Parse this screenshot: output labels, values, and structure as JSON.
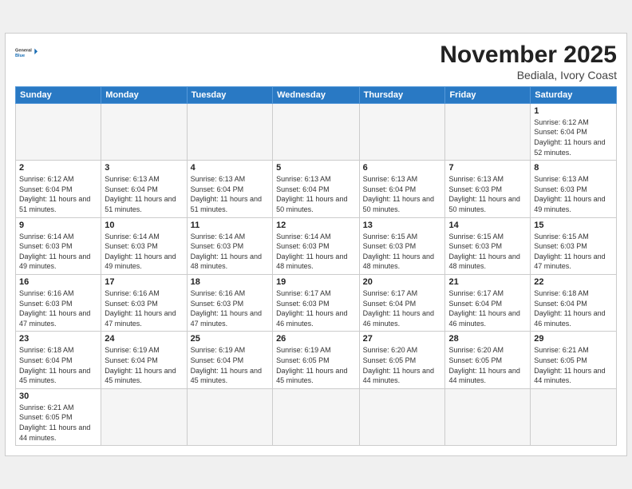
{
  "header": {
    "logo_general": "General",
    "logo_blue": "Blue",
    "month_title": "November 2025",
    "location": "Bediala, Ivory Coast"
  },
  "days_of_week": [
    "Sunday",
    "Monday",
    "Tuesday",
    "Wednesday",
    "Thursday",
    "Friday",
    "Saturday"
  ],
  "weeks": [
    [
      {
        "day": "",
        "sunrise": "",
        "sunset": "",
        "daylight": "",
        "empty": true
      },
      {
        "day": "",
        "sunrise": "",
        "sunset": "",
        "daylight": "",
        "empty": true
      },
      {
        "day": "",
        "sunrise": "",
        "sunset": "",
        "daylight": "",
        "empty": true
      },
      {
        "day": "",
        "sunrise": "",
        "sunset": "",
        "daylight": "",
        "empty": true
      },
      {
        "day": "",
        "sunrise": "",
        "sunset": "",
        "daylight": "",
        "empty": true
      },
      {
        "day": "",
        "sunrise": "",
        "sunset": "",
        "daylight": "",
        "empty": true
      },
      {
        "day": "1",
        "sunrise": "Sunrise: 6:12 AM",
        "sunset": "Sunset: 6:04 PM",
        "daylight": "Daylight: 11 hours and 52 minutes.",
        "empty": false
      }
    ],
    [
      {
        "day": "2",
        "sunrise": "Sunrise: 6:12 AM",
        "sunset": "Sunset: 6:04 PM",
        "daylight": "Daylight: 11 hours and 51 minutes.",
        "empty": false
      },
      {
        "day": "3",
        "sunrise": "Sunrise: 6:13 AM",
        "sunset": "Sunset: 6:04 PM",
        "daylight": "Daylight: 11 hours and 51 minutes.",
        "empty": false
      },
      {
        "day": "4",
        "sunrise": "Sunrise: 6:13 AM",
        "sunset": "Sunset: 6:04 PM",
        "daylight": "Daylight: 11 hours and 51 minutes.",
        "empty": false
      },
      {
        "day": "5",
        "sunrise": "Sunrise: 6:13 AM",
        "sunset": "Sunset: 6:04 PM",
        "daylight": "Daylight: 11 hours and 50 minutes.",
        "empty": false
      },
      {
        "day": "6",
        "sunrise": "Sunrise: 6:13 AM",
        "sunset": "Sunset: 6:04 PM",
        "daylight": "Daylight: 11 hours and 50 minutes.",
        "empty": false
      },
      {
        "day": "7",
        "sunrise": "Sunrise: 6:13 AM",
        "sunset": "Sunset: 6:03 PM",
        "daylight": "Daylight: 11 hours and 50 minutes.",
        "empty": false
      },
      {
        "day": "8",
        "sunrise": "Sunrise: 6:13 AM",
        "sunset": "Sunset: 6:03 PM",
        "daylight": "Daylight: 11 hours and 49 minutes.",
        "empty": false
      }
    ],
    [
      {
        "day": "9",
        "sunrise": "Sunrise: 6:14 AM",
        "sunset": "Sunset: 6:03 PM",
        "daylight": "Daylight: 11 hours and 49 minutes.",
        "empty": false
      },
      {
        "day": "10",
        "sunrise": "Sunrise: 6:14 AM",
        "sunset": "Sunset: 6:03 PM",
        "daylight": "Daylight: 11 hours and 49 minutes.",
        "empty": false
      },
      {
        "day": "11",
        "sunrise": "Sunrise: 6:14 AM",
        "sunset": "Sunset: 6:03 PM",
        "daylight": "Daylight: 11 hours and 48 minutes.",
        "empty": false
      },
      {
        "day": "12",
        "sunrise": "Sunrise: 6:14 AM",
        "sunset": "Sunset: 6:03 PM",
        "daylight": "Daylight: 11 hours and 48 minutes.",
        "empty": false
      },
      {
        "day": "13",
        "sunrise": "Sunrise: 6:15 AM",
        "sunset": "Sunset: 6:03 PM",
        "daylight": "Daylight: 11 hours and 48 minutes.",
        "empty": false
      },
      {
        "day": "14",
        "sunrise": "Sunrise: 6:15 AM",
        "sunset": "Sunset: 6:03 PM",
        "daylight": "Daylight: 11 hours and 48 minutes.",
        "empty": false
      },
      {
        "day": "15",
        "sunrise": "Sunrise: 6:15 AM",
        "sunset": "Sunset: 6:03 PM",
        "daylight": "Daylight: 11 hours and 47 minutes.",
        "empty": false
      }
    ],
    [
      {
        "day": "16",
        "sunrise": "Sunrise: 6:16 AM",
        "sunset": "Sunset: 6:03 PM",
        "daylight": "Daylight: 11 hours and 47 minutes.",
        "empty": false
      },
      {
        "day": "17",
        "sunrise": "Sunrise: 6:16 AM",
        "sunset": "Sunset: 6:03 PM",
        "daylight": "Daylight: 11 hours and 47 minutes.",
        "empty": false
      },
      {
        "day": "18",
        "sunrise": "Sunrise: 6:16 AM",
        "sunset": "Sunset: 6:03 PM",
        "daylight": "Daylight: 11 hours and 47 minutes.",
        "empty": false
      },
      {
        "day": "19",
        "sunrise": "Sunrise: 6:17 AM",
        "sunset": "Sunset: 6:03 PM",
        "daylight": "Daylight: 11 hours and 46 minutes.",
        "empty": false
      },
      {
        "day": "20",
        "sunrise": "Sunrise: 6:17 AM",
        "sunset": "Sunset: 6:04 PM",
        "daylight": "Daylight: 11 hours and 46 minutes.",
        "empty": false
      },
      {
        "day": "21",
        "sunrise": "Sunrise: 6:17 AM",
        "sunset": "Sunset: 6:04 PM",
        "daylight": "Daylight: 11 hours and 46 minutes.",
        "empty": false
      },
      {
        "day": "22",
        "sunrise": "Sunrise: 6:18 AM",
        "sunset": "Sunset: 6:04 PM",
        "daylight": "Daylight: 11 hours and 46 minutes.",
        "empty": false
      }
    ],
    [
      {
        "day": "23",
        "sunrise": "Sunrise: 6:18 AM",
        "sunset": "Sunset: 6:04 PM",
        "daylight": "Daylight: 11 hours and 45 minutes.",
        "empty": false
      },
      {
        "day": "24",
        "sunrise": "Sunrise: 6:19 AM",
        "sunset": "Sunset: 6:04 PM",
        "daylight": "Daylight: 11 hours and 45 minutes.",
        "empty": false
      },
      {
        "day": "25",
        "sunrise": "Sunrise: 6:19 AM",
        "sunset": "Sunset: 6:04 PM",
        "daylight": "Daylight: 11 hours and 45 minutes.",
        "empty": false
      },
      {
        "day": "26",
        "sunrise": "Sunrise: 6:19 AM",
        "sunset": "Sunset: 6:05 PM",
        "daylight": "Daylight: 11 hours and 45 minutes.",
        "empty": false
      },
      {
        "day": "27",
        "sunrise": "Sunrise: 6:20 AM",
        "sunset": "Sunset: 6:05 PM",
        "daylight": "Daylight: 11 hours and 44 minutes.",
        "empty": false
      },
      {
        "day": "28",
        "sunrise": "Sunrise: 6:20 AM",
        "sunset": "Sunset: 6:05 PM",
        "daylight": "Daylight: 11 hours and 44 minutes.",
        "empty": false
      },
      {
        "day": "29",
        "sunrise": "Sunrise: 6:21 AM",
        "sunset": "Sunset: 6:05 PM",
        "daylight": "Daylight: 11 hours and 44 minutes.",
        "empty": false
      }
    ],
    [
      {
        "day": "30",
        "sunrise": "Sunrise: 6:21 AM",
        "sunset": "Sunset: 6:05 PM",
        "daylight": "Daylight: 11 hours and 44 minutes.",
        "empty": false
      },
      {
        "day": "",
        "sunrise": "",
        "sunset": "",
        "daylight": "",
        "empty": true
      },
      {
        "day": "",
        "sunrise": "",
        "sunset": "",
        "daylight": "",
        "empty": true
      },
      {
        "day": "",
        "sunrise": "",
        "sunset": "",
        "daylight": "",
        "empty": true
      },
      {
        "day": "",
        "sunrise": "",
        "sunset": "",
        "daylight": "",
        "empty": true
      },
      {
        "day": "",
        "sunrise": "",
        "sunset": "",
        "daylight": "",
        "empty": true
      },
      {
        "day": "",
        "sunrise": "",
        "sunset": "",
        "daylight": "",
        "empty": true
      }
    ]
  ]
}
